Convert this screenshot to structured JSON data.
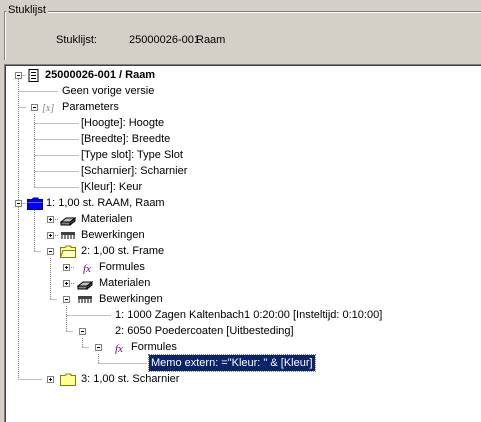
{
  "group": {
    "title": "Stuklijst",
    "label": "Stuklijst:",
    "value": "25000026-001",
    "name": "Raam"
  },
  "tree": {
    "root": "25000026-001 / Raam",
    "no_previous": "Geen vorige versie",
    "parameters": "Parameters",
    "params": [
      "[Hoogte]: Hoogte",
      "[Breedte]: Breedte",
      "[Type slot]: Type Slot",
      "[Scharnier]: Scharnier",
      "[Kleur]: Keur"
    ],
    "item1": "1: 1,00 st. RAAM, Raam",
    "item1_materialen": "Materialen",
    "item1_bewerkingen": "Bewerkingen",
    "item2": "2: 1,00 st.  Frame",
    "item2_formules": "Formules",
    "item2_materialen": "Materialen",
    "item2_bewerkingen": "Bewerkingen",
    "op1": "1: 1000 Zagen Kaltenbach1 0:20:00 [Insteltijd: 0:10:00]",
    "op2": "2: 6050 Poedercoaten [Uitbesteding]",
    "op2_formules": "Formules",
    "memo": "Memo extern: =\"Kleur: \" & [Kleur]",
    "item3": "3: 1,00 st.  Scharnier"
  },
  "icons": {
    "document": "document-icon",
    "parameters": "parameters-icon",
    "folder_blue": "folder-blue-icon",
    "folder_yellow": "folder-yellow-icon",
    "materials": "materials-icon",
    "operations": "operations-icon",
    "formula": "formula-icon"
  },
  "colors": {
    "window": "#d4d0c8",
    "tree_bg": "#ffffff",
    "selection": "#0a246a",
    "folder_blue": "#0000ff",
    "folder_yellow": "#ffff99"
  }
}
